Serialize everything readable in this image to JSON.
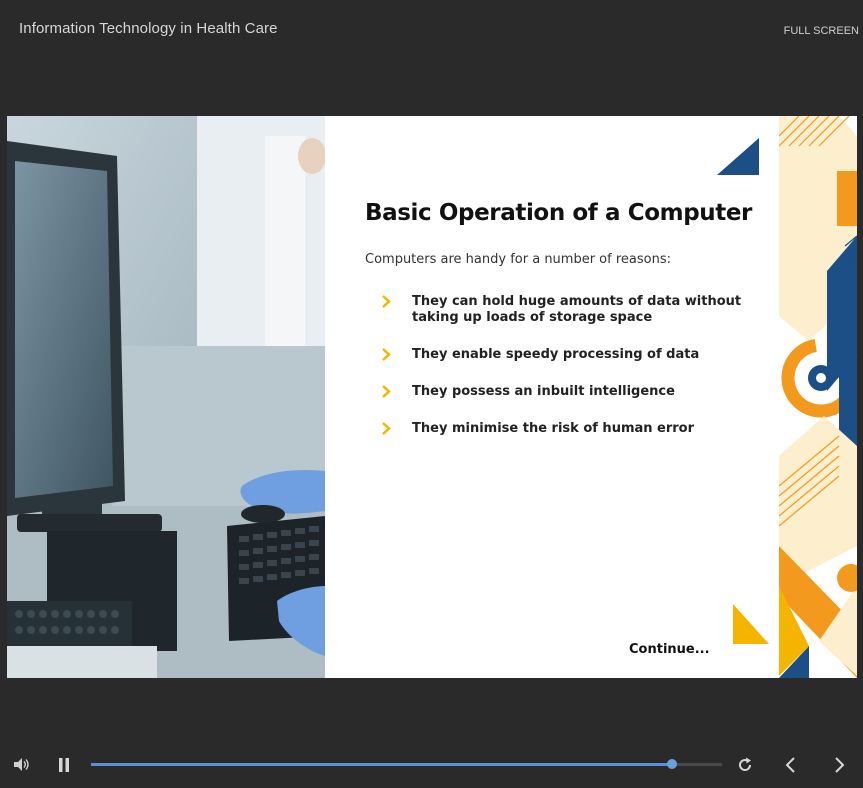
{
  "header": {
    "course_title": "Information Technology in Health Care",
    "fullscreen_label": "FULL SCREEN"
  },
  "slide": {
    "heading": "Basic Operation of a Computer",
    "intro": "Computers are handy for a number of reasons:",
    "bullets": [
      "They can hold huge amounts of data without taking up loads of storage space",
      "They enable speedy processing of data",
      "They possess an inbuilt intelligence",
      "They minimise the risk of human error"
    ],
    "continue_label": "Continue...",
    "photo_subject": "lab-computer-keyboard-gloved-hands"
  },
  "player": {
    "progress_fraction": 0.92,
    "icons": [
      "volume-icon",
      "pause-icon",
      "replay-icon",
      "prev-icon",
      "next-icon"
    ]
  },
  "colors": {
    "background": "#2a2a2a",
    "accent_yellow": "#f5b400",
    "accent_orange": "#f39a1e",
    "accent_navy": "#1b4f86",
    "progress_blue": "#5b8fcf"
  }
}
